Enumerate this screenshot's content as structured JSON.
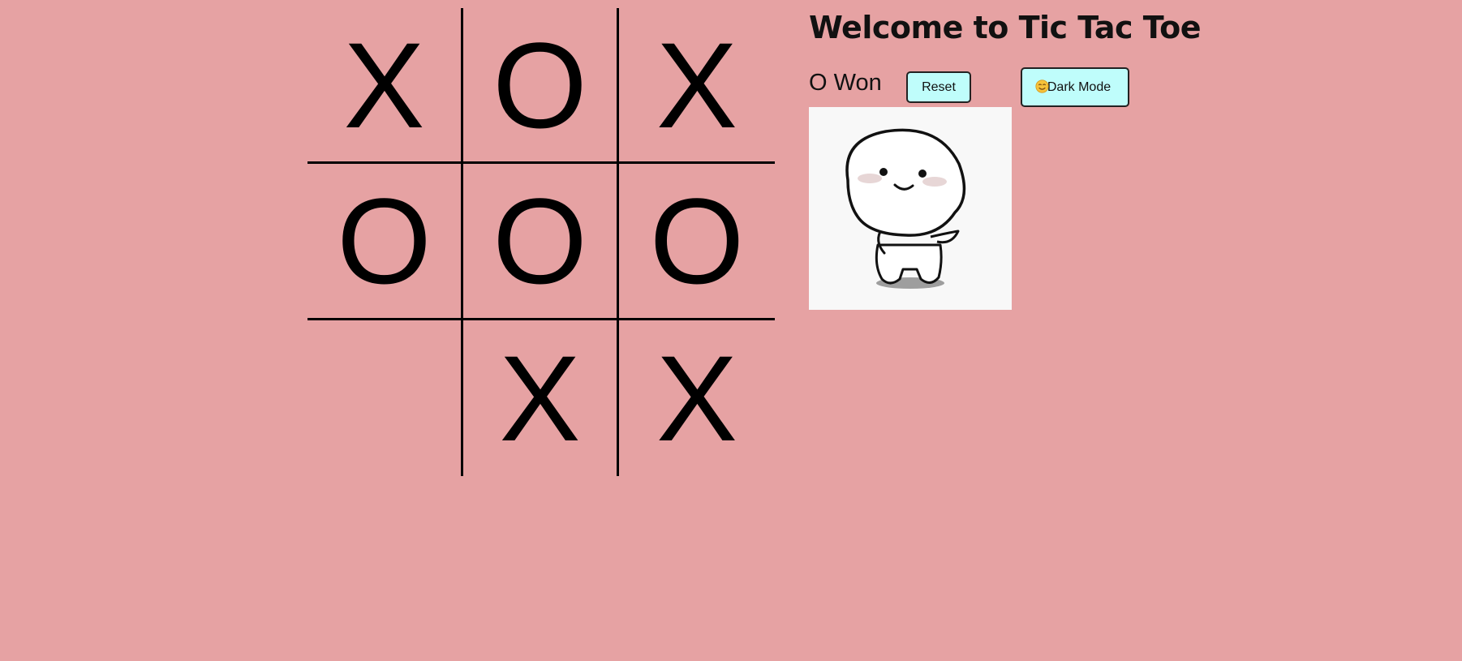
{
  "header": {
    "title": "Welcome to Tic Tac Toe"
  },
  "status": {
    "text": "O Won"
  },
  "buttons": {
    "reset_label": "Reset",
    "dark_mode_label": "Dark Mode",
    "dark_mode_icon": "smiling-face-emoji-icon"
  },
  "board": {
    "cells": [
      "X",
      "O",
      "X",
      "O",
      "O",
      "O",
      "",
      "X",
      "X"
    ]
  },
  "celebration_image": {
    "icon": "cute-dancing-character-icon"
  },
  "colors": {
    "background": "#e6a2a3",
    "button_background": "#bffdfb",
    "grid_lines": "#000000"
  }
}
